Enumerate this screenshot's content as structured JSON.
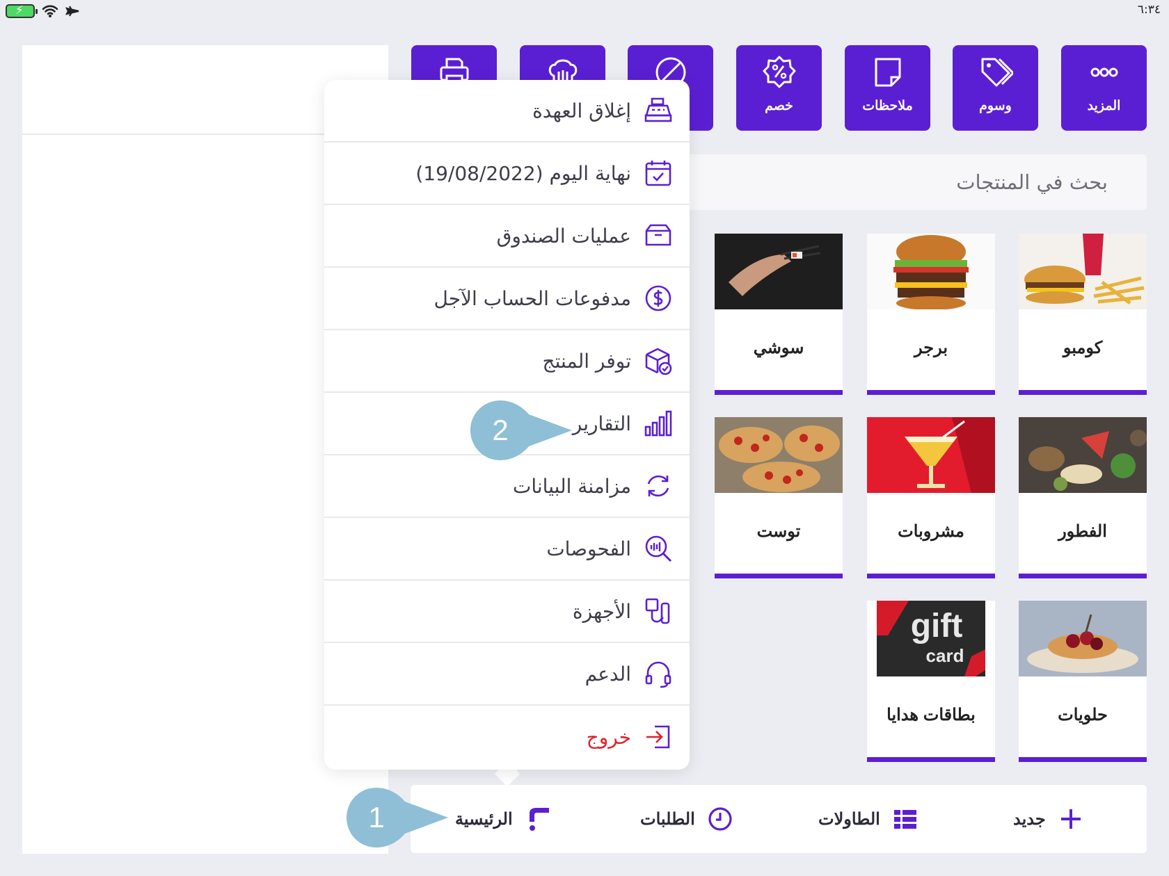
{
  "status_bar": {
    "time": "٦:٣٤",
    "icons": [
      "battery-charging-icon",
      "wifi-icon",
      "airplane-icon"
    ]
  },
  "toolbar": {
    "buttons": [
      {
        "label": "المزيد",
        "icon": "more-dots-icon"
      },
      {
        "label": "وسوم",
        "icon": "tags-icon"
      },
      {
        "label": "ملاحظات",
        "icon": "note-icon"
      },
      {
        "label": "خصم",
        "icon": "discount-icon"
      },
      {
        "label": "",
        "icon": "void-icon"
      },
      {
        "label": "",
        "icon": "kitchen-hat-icon"
      },
      {
        "label": "",
        "icon": "printer-icon"
      }
    ]
  },
  "search": {
    "placeholder": "بحث في المنتجات"
  },
  "categories": [
    {
      "name": "كومبو",
      "image": "combo-image"
    },
    {
      "name": "برجر",
      "image": "burger-image"
    },
    {
      "name": "سوشي",
      "image": "sushi-image"
    },
    {
      "name": "الفطور",
      "image": "breakfast-image"
    },
    {
      "name": "مشروبات",
      "image": "drinks-image"
    },
    {
      "name": "توست",
      "image": "toast-image"
    },
    {
      "name": "حلويات",
      "image": "desserts-image"
    },
    {
      "name": "بطاقات هدايا",
      "image": "gift-card-image"
    }
  ],
  "gift_card_image_text": {
    "line1": "gift",
    "line2": "card"
  },
  "menu": {
    "items": [
      {
        "label": "إغلاق العهدة",
        "icon": "cash-register-icon"
      },
      {
        "label": "نهاية اليوم (19/08/2022)",
        "icon": "calendar-check-icon"
      },
      {
        "label": "عمليات الصندوق",
        "icon": "cash-drawer-icon"
      },
      {
        "label": "مدفوعات الحساب الآجل",
        "icon": "dollar-circle-icon"
      },
      {
        "label": "توفر المنتج",
        "icon": "box-check-icon"
      },
      {
        "label": "التقارير",
        "icon": "bar-chart-icon"
      },
      {
        "label": "مزامنة البيانات",
        "icon": "sync-icon"
      },
      {
        "label": "الفحوصات",
        "icon": "diagnostics-icon"
      },
      {
        "label": "الأجهزة",
        "icon": "devices-icon"
      },
      {
        "label": "الدعم",
        "icon": "headset-icon"
      },
      {
        "label": "خروج",
        "icon": "logout-icon"
      }
    ]
  },
  "bottom_nav": {
    "items": [
      {
        "label": "جديد",
        "icon": "plus-icon"
      },
      {
        "label": "الطاولات",
        "icon": "tables-icon"
      },
      {
        "label": "الطلبات",
        "icon": "clock-icon"
      },
      {
        "label": "الرئيسية",
        "icon": "foodics-logo-icon"
      }
    ]
  },
  "callouts": [
    {
      "number": "1"
    },
    {
      "number": "2"
    }
  ],
  "colors": {
    "accent": "#5b1fd3",
    "callout": "#8ebfd6",
    "exit": "#e0202a",
    "background": "#ecedf2"
  }
}
